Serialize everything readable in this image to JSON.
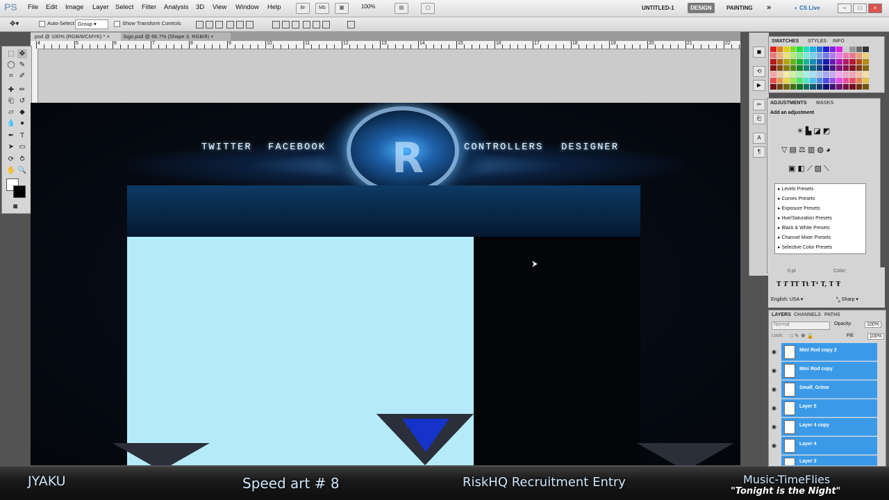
{
  "menubar": {
    "app_logo": "PS",
    "items": [
      "File",
      "Edit",
      "Image",
      "Layer",
      "Select",
      "Filter",
      "Analysis",
      "3D",
      "View",
      "Window",
      "Help"
    ],
    "zoom": "100%",
    "doc_title": "UNTITLED-1",
    "workspaces": [
      "DESIGN",
      "PAINTING"
    ],
    "cslive": "CS Live"
  },
  "options": {
    "auto_select_label": "Auto-Select:",
    "auto_select_value": "Group",
    "transform_label": "Show Transform Controls"
  },
  "tabs": [
    {
      "label": ".psd @ 100% (RGB/8/CMYK) *"
    },
    {
      "label": "logo.psd @ 66.7% (Shape 3, RGB/8)"
    }
  ],
  "ruler": {
    "numbers": [
      "4",
      "5",
      "6",
      "7",
      "8",
      "9",
      "10",
      "11",
      "12",
      "13",
      "14",
      "15",
      "16",
      "17",
      "18",
      "19",
      "20",
      "21",
      "22"
    ]
  },
  "canvas": {
    "nav_left": [
      "TWITTER",
      "FACEBOOK"
    ],
    "nav_right": [
      "CONTROLLERS",
      "DESIGNER"
    ],
    "colors": {
      "content": "#b5ebf9",
      "band": "#0d3a64"
    }
  },
  "panels": {
    "swatches_tabs": [
      "SWATCHES",
      "STYLES",
      "INFO"
    ],
    "adjust_tabs": [
      "ADJUSTMENTS",
      "MASKS"
    ],
    "adjust_title": "Add an adjustment",
    "presets": [
      "Levels Presets",
      "Curves Presets",
      "Exposure Presets",
      "Hue/Saturation Presets",
      "Black & White Presets",
      "Channel Mixer Presets",
      "Selective Color Presets"
    ],
    "char": {
      "lang": "English: USA",
      "aa": "Sharp",
      "size": "0 pt",
      "color_label": "Color:"
    },
    "layers_tabs": [
      "LAYERS",
      "CHANNELS",
      "PATHS"
    ],
    "blend": "Normal",
    "opacity_label": "Opacity:",
    "opacity": "100%",
    "lock_label": "Lock:",
    "fill_label": "Fill:",
    "fill": "100%",
    "layers": [
      "Mini Rod copy 2",
      "Mini Rod copy",
      "Small_Grime",
      "Layer 5",
      "Layer 4 copy",
      "Layer 4",
      "Layer 3"
    ]
  },
  "overlay": {
    "author": "JYAKU",
    "title": "Speed art # 8",
    "subtitle": "RiskHQ Recruitment Entry",
    "music": "Music-TimeFlies",
    "song": "\"Tonight is the Night\""
  }
}
